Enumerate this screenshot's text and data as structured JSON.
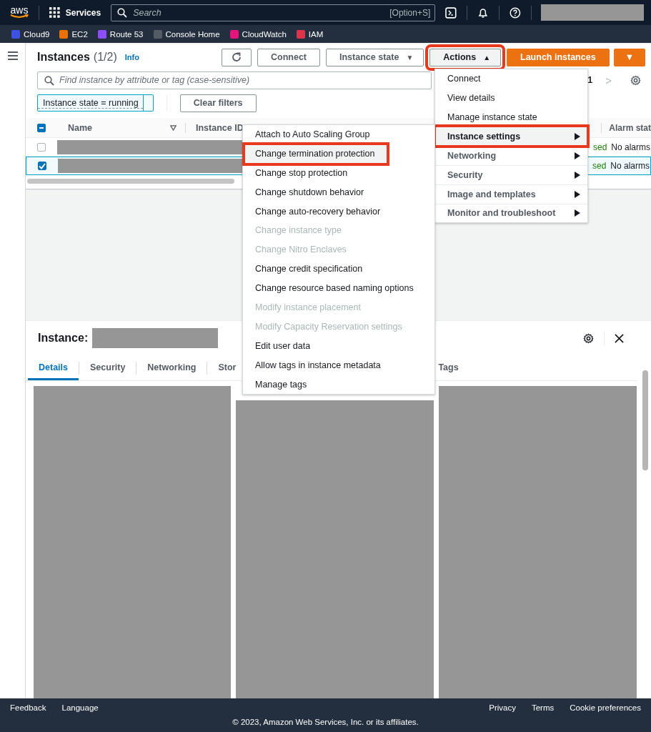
{
  "nav": {
    "logo_text": "aws",
    "services_label": "Services",
    "search": {
      "placeholder": "Search",
      "shortcut": "[Option+S]"
    }
  },
  "favorites": [
    {
      "label": "Cloud9",
      "color": "#3f51e0"
    },
    {
      "label": "EC2",
      "color": "#ed7100"
    },
    {
      "label": "Route 53",
      "color": "#8c4fff"
    },
    {
      "label": "Console Home",
      "color": "#545b64"
    },
    {
      "label": "CloudWatch",
      "color": "#e7157b"
    },
    {
      "label": "IAM",
      "color": "#dd344c"
    }
  ],
  "instances": {
    "title": "Instances",
    "count": "(1/2)",
    "info": "Info",
    "buttons": [
      {
        "kind": "refresh",
        "highlighted": false
      },
      {
        "kind": "plain",
        "label": "Connect",
        "highlighted": false
      },
      {
        "kind": "dropdown",
        "label": "Instance state",
        "caret": "▼",
        "highlighted": false
      },
      {
        "kind": "dropdown",
        "label": "Actions",
        "caret": "▲",
        "highlighted": true
      },
      {
        "kind": "primary",
        "label": "Launch instances",
        "highlighted": false
      },
      {
        "kind": "primary-caret",
        "label": "▼",
        "highlighted": false
      }
    ],
    "search": {
      "placeholder": "Find instance by attribute or tag (case-sensitive)"
    },
    "page": "1",
    "page_next": ">",
    "filter_token": "Instance state = running",
    "clear_filters": "Clear filters",
    "header_checkbox": {
      "indeterminate": true
    },
    "columns": [
      "Name",
      "Instance ID",
      "Alarm stat"
    ],
    "rows": [
      {
        "selected": false,
        "status": "sed",
        "alarm": "No alarms"
      },
      {
        "selected": true,
        "status": "sed",
        "alarm": "No alarms"
      }
    ]
  },
  "actions_menu": [
    {
      "label": "Connect",
      "kind": "item",
      "disabled": false,
      "highlighted": false
    },
    {
      "label": "View details",
      "kind": "item",
      "disabled": false,
      "highlighted": false
    },
    {
      "label": "Manage instance state",
      "kind": "item",
      "disabled": false,
      "highlighted": false
    },
    {
      "label": "Instance settings",
      "kind": "submenu",
      "disabled": false,
      "highlighted": true
    },
    {
      "label": "Networking",
      "kind": "submenu",
      "disabled": false,
      "highlighted": false
    },
    {
      "label": "Security",
      "kind": "submenu",
      "disabled": false,
      "highlighted": false
    },
    {
      "label": "Image and templates",
      "kind": "submenu",
      "disabled": false,
      "highlighted": false
    },
    {
      "label": "Monitor and troubleshoot",
      "kind": "submenu",
      "disabled": false,
      "highlighted": false
    }
  ],
  "settings_submenu": [
    {
      "label": "Attach to Auto Scaling Group",
      "disabled": false,
      "highlighted": false
    },
    {
      "label": "Change termination protection",
      "disabled": false,
      "highlighted": true
    },
    {
      "label": "Change stop protection",
      "disabled": false,
      "highlighted": false
    },
    {
      "label": "Change shutdown behavior",
      "disabled": false,
      "highlighted": false
    },
    {
      "label": "Change auto-recovery behavior",
      "disabled": false,
      "highlighted": false
    },
    {
      "label": "Change instance type",
      "disabled": true,
      "highlighted": false
    },
    {
      "label": "Change Nitro Enclaves",
      "disabled": true,
      "highlighted": false
    },
    {
      "label": "Change credit specification",
      "disabled": false,
      "highlighted": false
    },
    {
      "label": "Change resource based naming options",
      "disabled": false,
      "highlighted": false
    },
    {
      "label": "Modify instance placement",
      "disabled": true,
      "highlighted": false
    },
    {
      "label": "Modify Capacity Reservation settings",
      "disabled": true,
      "highlighted": false
    },
    {
      "label": "Edit user data",
      "disabled": false,
      "highlighted": false
    },
    {
      "label": "Allow tags in instance metadata",
      "disabled": false,
      "highlighted": false
    },
    {
      "label": "Manage tags",
      "disabled": false,
      "highlighted": false
    }
  ],
  "detail": {
    "title": "Instance:",
    "tabs": [
      {
        "label": "Details",
        "selected": true
      },
      {
        "label": "Security",
        "selected": false
      },
      {
        "label": "Networking",
        "selected": false
      },
      {
        "label": "Stor",
        "selected": false
      },
      {
        "label": "Tags",
        "selected": false
      }
    ]
  },
  "footer": {
    "left": [
      "Feedback",
      "Language"
    ],
    "right": [
      "Privacy",
      "Terms",
      "Cookie preferences"
    ],
    "copyright": "© 2023, Amazon Web Services, Inc. or its affiliates."
  }
}
